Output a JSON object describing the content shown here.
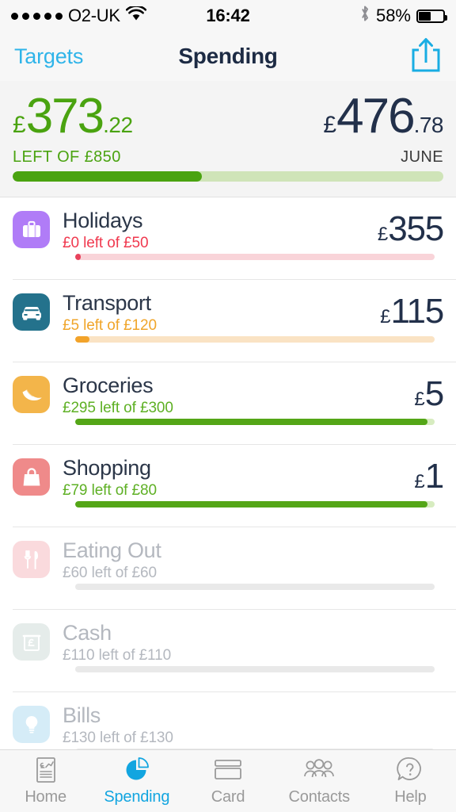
{
  "status_bar": {
    "signal_dots": 5,
    "carrier": "O2-UK",
    "wifi_icon": "wifi-icon",
    "time": "16:42",
    "bluetooth_icon": "bluetooth-icon",
    "battery_percent": "58%",
    "battery_level": 58
  },
  "nav": {
    "back_label": "Targets",
    "title": "Spending",
    "share_icon": "share-icon"
  },
  "summary": {
    "left": {
      "currency": "£",
      "integer": "373",
      "decimal": ".22",
      "label": "LEFT OF £850",
      "color": "#4aa310"
    },
    "right": {
      "currency": "£",
      "integer": "476",
      "decimal": ".78",
      "label": "JUNE",
      "color": "#22304a"
    },
    "progress_percent": 44,
    "progress_fill_color": "#4aa310",
    "progress_track_color": "#cfe4b8"
  },
  "categories": [
    {
      "name": "Holidays",
      "icon": "suitcase-icon",
      "icon_bg": "#b07cf7",
      "subtitle": "£0 left of £50",
      "subtitle_color": "#f0394f",
      "amount_currency": "£",
      "amount": "355",
      "progress_percent": 0,
      "bar_fill_color": "#e8425c",
      "bar_track_color": "#f9d4d9",
      "dimmed": false
    },
    {
      "name": "Transport",
      "icon": "car-icon",
      "icon_bg": "#24728c",
      "subtitle": "£5 left of £120",
      "subtitle_color": "#f0a52a",
      "amount_currency": "£",
      "amount": "115",
      "progress_percent": 4,
      "bar_fill_color": "#f2a32a",
      "bar_track_color": "#fae3c4",
      "dimmed": false
    },
    {
      "name": "Groceries",
      "icon": "banana-icon",
      "icon_bg": "#f3b54a",
      "subtitle": "£295 left of £300",
      "subtitle_color": "#5eb024",
      "amount_currency": "£",
      "amount": "5",
      "progress_percent": 98,
      "bar_fill_color": "#54a617",
      "bar_track_color": "#d7ecc0",
      "dimmed": false
    },
    {
      "name": "Shopping",
      "icon": "shopping-bag-icon",
      "icon_bg": "#ef8a8a",
      "subtitle": "£79 left of £80",
      "subtitle_color": "#5eb024",
      "amount_currency": "£",
      "amount": "1",
      "progress_percent": 98,
      "bar_fill_color": "#54a617",
      "bar_track_color": "#d7ecc0",
      "dimmed": false
    },
    {
      "name": "Eating Out",
      "icon": "cutlery-icon",
      "icon_bg": "#fadadd",
      "subtitle": "£60 left of £60",
      "subtitle_color": "#b4b8bf",
      "amount_currency": "",
      "amount": "",
      "progress_percent": 0,
      "bar_fill_color": "#e9e9e9",
      "bar_track_color": "#e9e9e9",
      "dimmed": true
    },
    {
      "name": "Cash",
      "icon": "banknote-icon",
      "icon_bg": "#e5ecea",
      "subtitle": "£110 left of £110",
      "subtitle_color": "#b4b8bf",
      "amount_currency": "",
      "amount": "",
      "progress_percent": 0,
      "bar_fill_color": "#e9e9e9",
      "bar_track_color": "#e9e9e9",
      "dimmed": true
    },
    {
      "name": "Bills",
      "icon": "lightbulb-icon",
      "icon_bg": "#d5ecf7",
      "subtitle": "£130 left of £130",
      "subtitle_color": "#b4b8bf",
      "amount_currency": "",
      "amount": "",
      "progress_percent": 0,
      "bar_fill_color": "#e9e9e9",
      "bar_track_color": "#e9e9e9",
      "dimmed": true
    }
  ],
  "tabs": [
    {
      "label": "Home",
      "icon": "statement-icon",
      "active": false
    },
    {
      "label": "Spending",
      "icon": "pie-chart-icon",
      "active": true
    },
    {
      "label": "Card",
      "icon": "credit-card-icon",
      "active": false
    },
    {
      "label": "Contacts",
      "icon": "people-icon",
      "active": false
    },
    {
      "label": "Help",
      "icon": "question-bubble-icon",
      "active": false
    }
  ],
  "colors": {
    "accent_blue": "#12a5e0",
    "nav_blue": "#2fb4e9",
    "navy": "#22304a",
    "green": "#4aa310",
    "red": "#f0394f",
    "orange": "#f0a52a"
  }
}
